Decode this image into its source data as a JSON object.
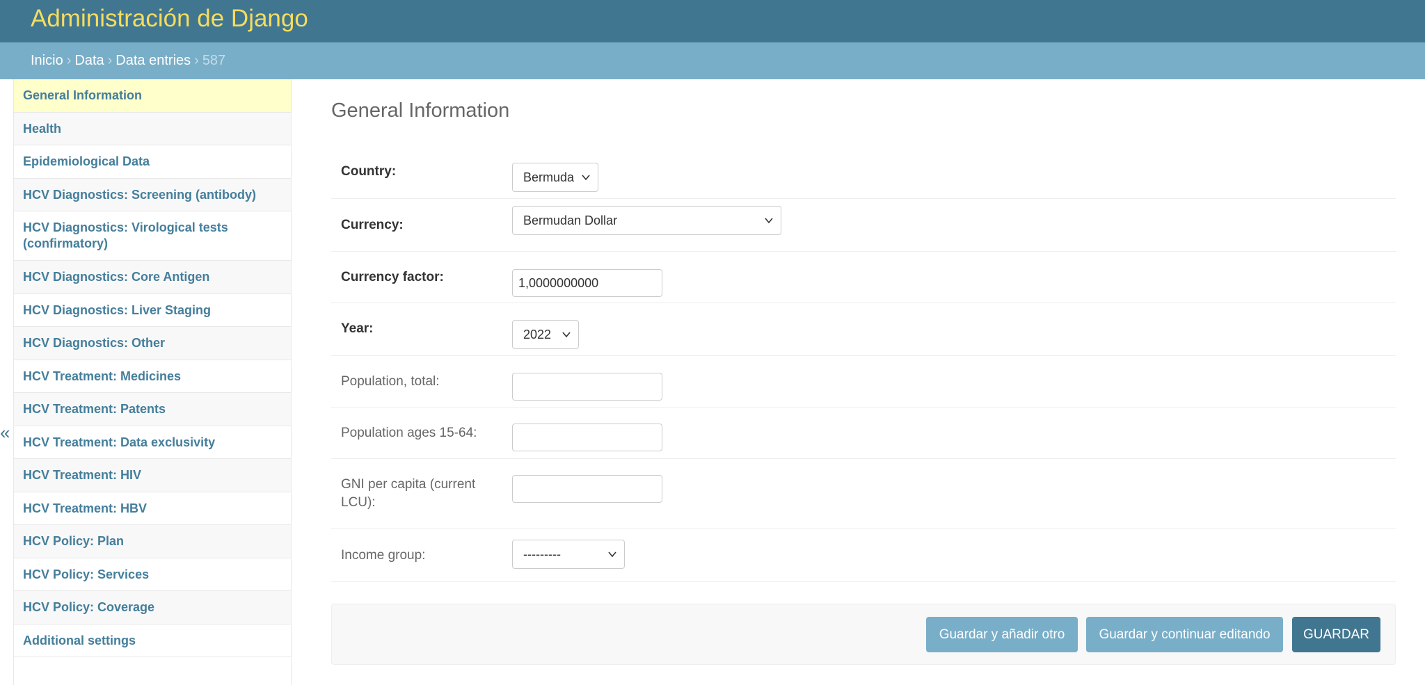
{
  "header": {
    "site_name": "Administración de Django"
  },
  "breadcrumbs": {
    "items": [
      "Inicio",
      "Data",
      "Data entries"
    ],
    "separator": "›",
    "current": "587"
  },
  "sidebar": {
    "toggle_icon": "«",
    "items": [
      {
        "label": "General Information",
        "active": true
      },
      {
        "label": "Health"
      },
      {
        "label": "Epidemiological Data"
      },
      {
        "label": "HCV Diagnostics: Screening (antibody)"
      },
      {
        "label": "HCV Diagnostics: Virological tests (confirmatory)"
      },
      {
        "label": "HCV Diagnostics: Core Antigen"
      },
      {
        "label": "HCV Diagnostics: Liver Staging"
      },
      {
        "label": "HCV Diagnostics: Other"
      },
      {
        "label": "HCV Treatment: Medicines"
      },
      {
        "label": "HCV Treatment: Patents"
      },
      {
        "label": "HCV Treatment: Data exclusivity"
      },
      {
        "label": "HCV Treatment: HIV"
      },
      {
        "label": "HCV Treatment: HBV"
      },
      {
        "label": "HCV Policy: Plan"
      },
      {
        "label": "HCV Policy: Services"
      },
      {
        "label": "HCV Policy: Coverage"
      },
      {
        "label": "Additional settings"
      }
    ]
  },
  "main": {
    "section_title": "General Information",
    "fields": {
      "country": {
        "label": "Country:",
        "value": "Bermuda"
      },
      "currency": {
        "label": "Currency:",
        "value": "Bermudan Dollar"
      },
      "currency_factor": {
        "label": "Currency factor:",
        "value": "1,0000000000"
      },
      "year": {
        "label": "Year:",
        "value": "2022"
      },
      "population_total": {
        "label": "Population, total:",
        "value": ""
      },
      "population_15_64": {
        "label": "Population ages 15-64:",
        "value": ""
      },
      "gni_per_capita": {
        "label": "GNI per capita (current LCU):",
        "value": ""
      },
      "income_group": {
        "label": "Income group:",
        "value": "---------"
      }
    }
  },
  "actions": {
    "save_add_another": "Guardar y añadir otro",
    "save_continue": "Guardar y continuar editando",
    "save": "GUARDAR"
  },
  "colors": {
    "header_bg": "#417690",
    "site_name": "#f5dd5d",
    "breadcrumbs_bg": "#79aec8",
    "link": "#447e9b",
    "active_item_bg": "#ffffcc",
    "primary_button": "#417690",
    "secondary_button": "#79aec8"
  }
}
